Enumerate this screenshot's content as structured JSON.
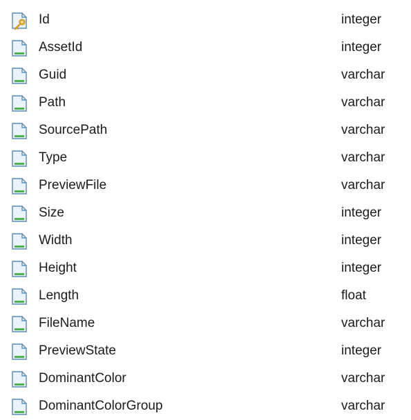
{
  "columns": [
    {
      "name": "Id",
      "type": "integer",
      "icon": "primary-key-column-icon"
    },
    {
      "name": "AssetId",
      "type": "integer",
      "icon": "column-icon"
    },
    {
      "name": "Guid",
      "type": "varchar",
      "icon": "column-icon"
    },
    {
      "name": "Path",
      "type": "varchar",
      "icon": "column-icon"
    },
    {
      "name": "SourcePath",
      "type": "varchar",
      "icon": "column-icon"
    },
    {
      "name": "Type",
      "type": "varchar",
      "icon": "column-icon"
    },
    {
      "name": "PreviewFile",
      "type": "varchar",
      "icon": "column-icon"
    },
    {
      "name": "Size",
      "type": "integer",
      "icon": "column-icon"
    },
    {
      "name": "Width",
      "type": "integer",
      "icon": "column-icon"
    },
    {
      "name": "Height",
      "type": "integer",
      "icon": "column-icon"
    },
    {
      "name": "Length",
      "type": "float",
      "icon": "column-icon"
    },
    {
      "name": "FileName",
      "type": "varchar",
      "icon": "column-icon"
    },
    {
      "name": "PreviewState",
      "type": "integer",
      "icon": "column-icon"
    },
    {
      "name": "DominantColor",
      "type": "varchar",
      "icon": "column-icon"
    },
    {
      "name": "DominantColorGroup",
      "type": "varchar",
      "icon": "column-icon"
    }
  ],
  "colors": {
    "text": "#1b1b1b",
    "icon_fill": "#eaf3fb",
    "icon_border": "#5b8bb6",
    "icon_bar": "#4fb04f",
    "key": "#e8b53c"
  }
}
